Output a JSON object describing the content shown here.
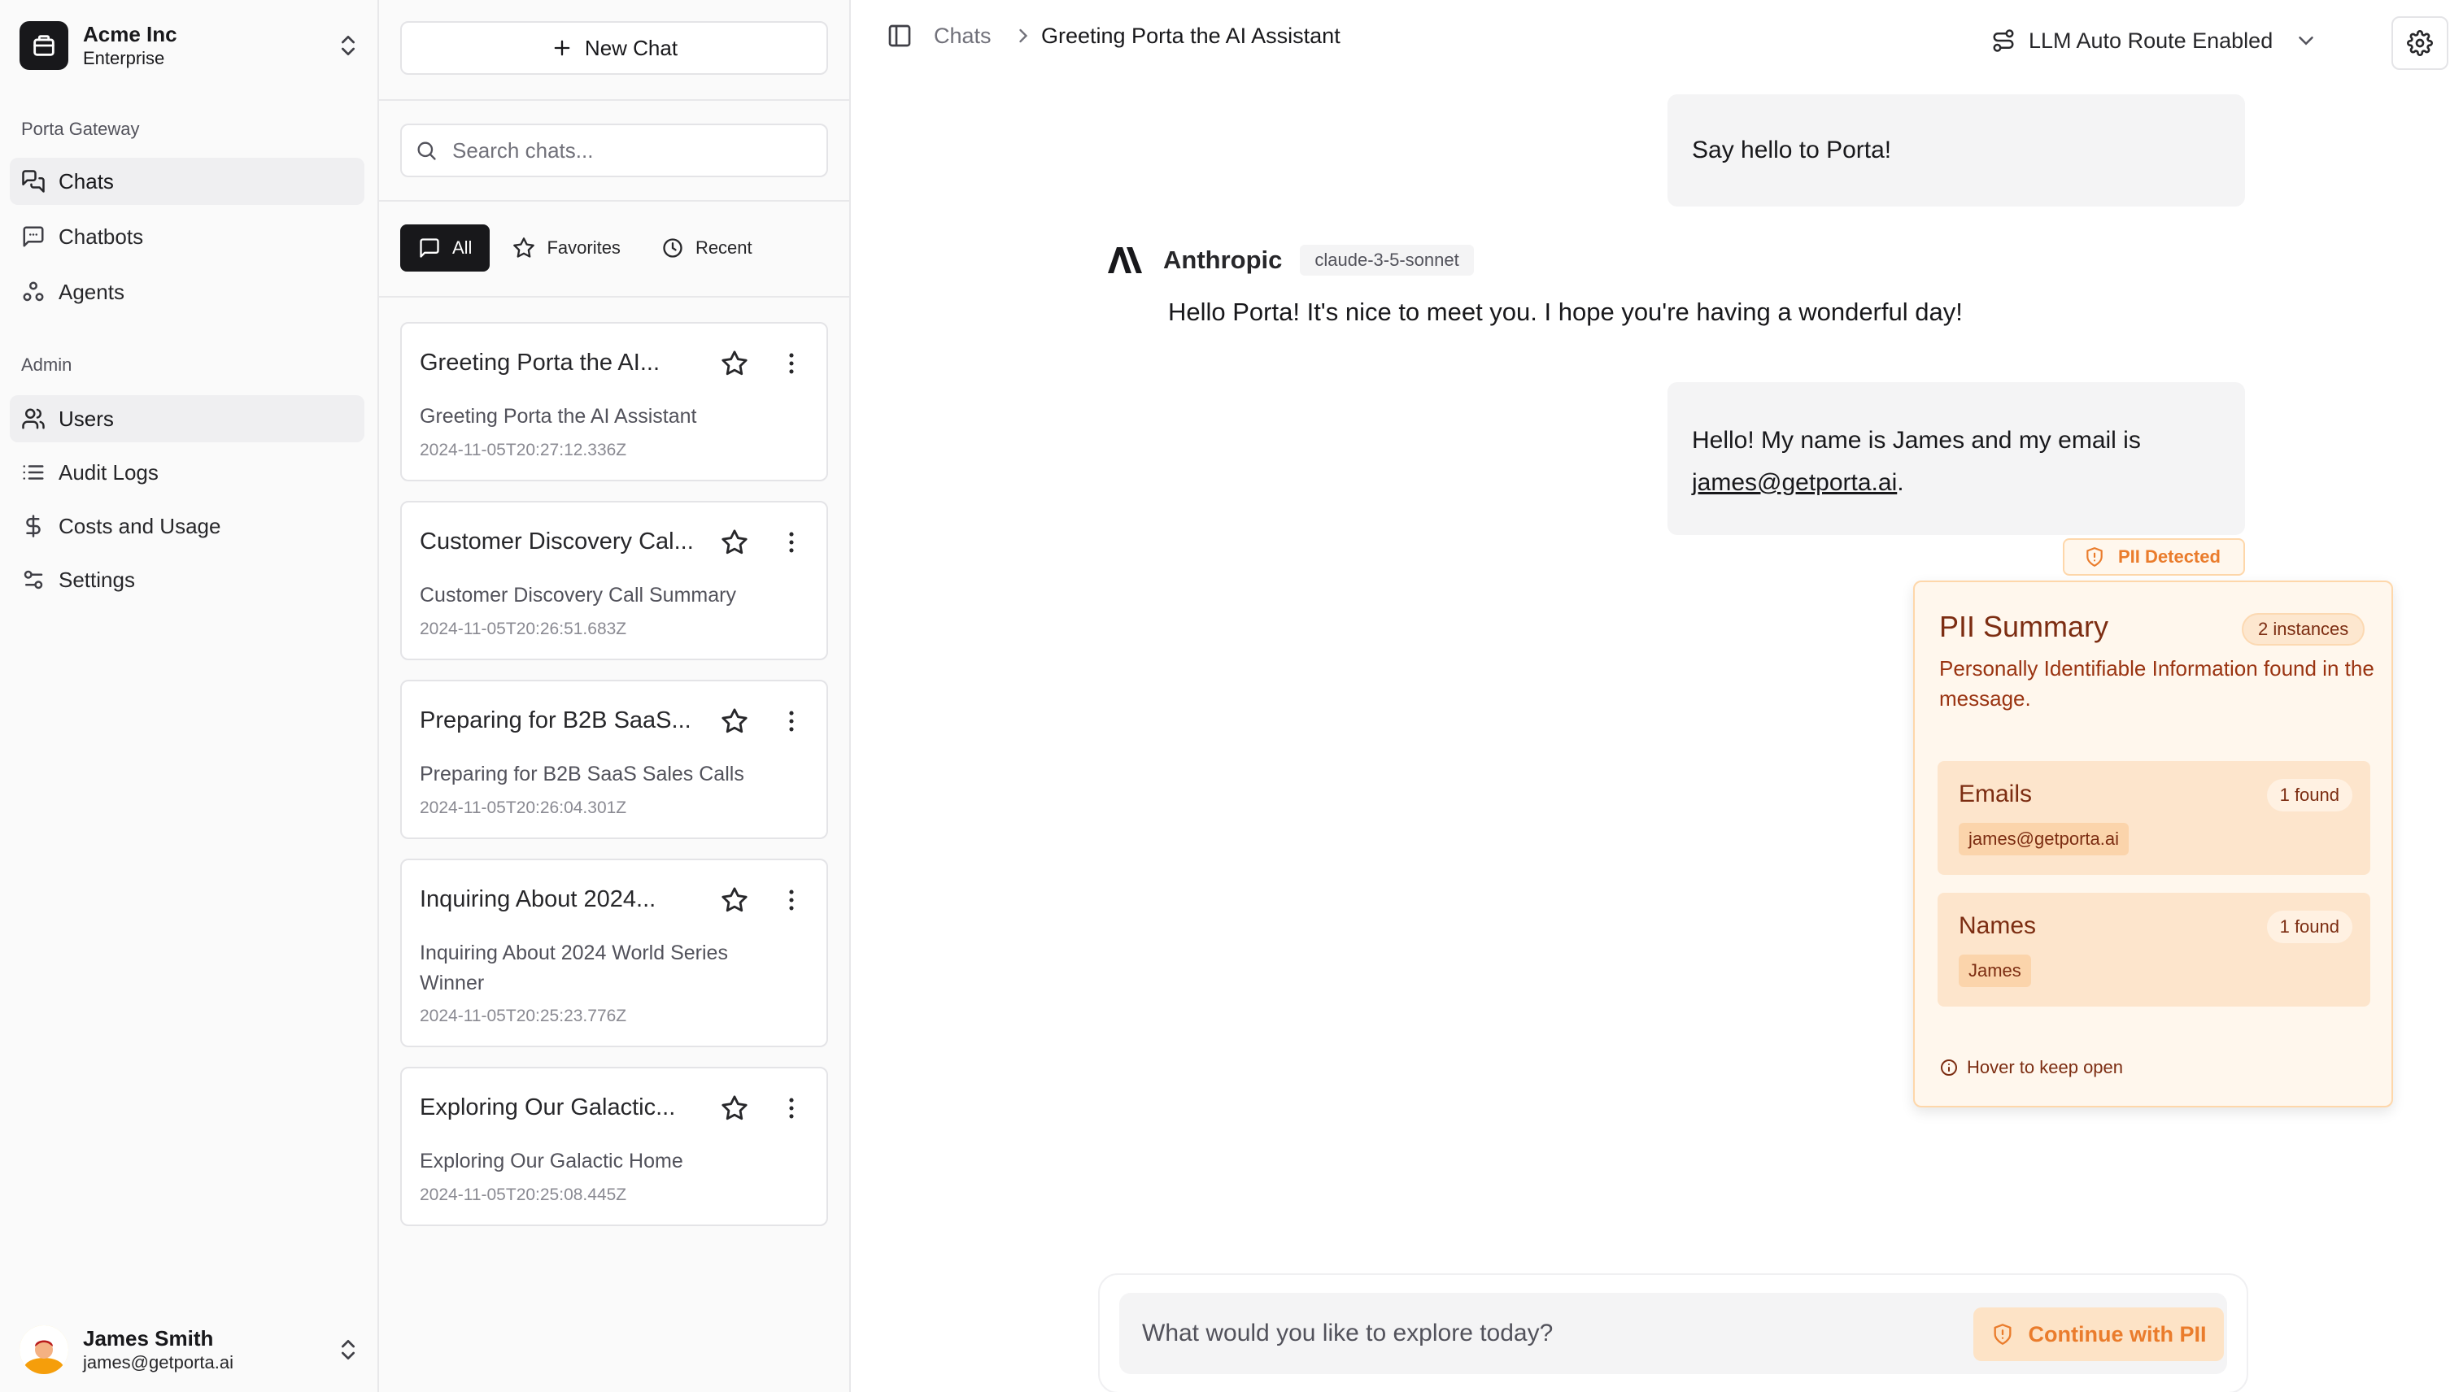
{
  "org": {
    "name": "Acme Inc",
    "plan": "Enterprise"
  },
  "sidebar": {
    "gateway_label": "Porta Gateway",
    "gateway_items": [
      {
        "label": "Chats",
        "icon": "chats-icon",
        "active": true
      },
      {
        "label": "Chatbots",
        "icon": "chatbot-icon",
        "active": false
      },
      {
        "label": "Agents",
        "icon": "agents-icon",
        "active": false
      }
    ],
    "admin_label": "Admin",
    "admin_items": [
      {
        "label": "Users",
        "icon": "users-icon",
        "active": true
      },
      {
        "label": "Audit Logs",
        "icon": "list-icon",
        "active": false
      },
      {
        "label": "Costs and Usage",
        "icon": "dollar-icon",
        "active": false
      },
      {
        "label": "Settings",
        "icon": "sliders-icon",
        "active": false
      }
    ]
  },
  "user": {
    "name": "James Smith",
    "email": "james@getporta.ai"
  },
  "chat_list": {
    "new_chat_label": "New Chat",
    "search_placeholder": "Search chats...",
    "filters": [
      "All",
      "Favorites",
      "Recent"
    ],
    "active_filter": "All",
    "items": [
      {
        "title": "Greeting Porta the AI...",
        "subtitle": "Greeting Porta the AI Assistant",
        "date": "2024-11-05T20:27:12.336Z"
      },
      {
        "title": "Customer Discovery Cal...",
        "subtitle": "Customer Discovery Call Summary",
        "date": "2024-11-05T20:26:51.683Z"
      },
      {
        "title": "Preparing for B2B SaaS...",
        "subtitle": "Preparing for B2B SaaS Sales Calls",
        "date": "2024-11-05T20:26:04.301Z"
      },
      {
        "title": "Inquiring About 2024...",
        "subtitle": "Inquiring About 2024 World Series Winner",
        "date": "2024-11-05T20:25:23.776Z"
      },
      {
        "title": "Exploring Our Galactic...",
        "subtitle": "Exploring Our Galactic Home",
        "date": "2024-11-05T20:25:08.445Z"
      }
    ]
  },
  "breadcrumb": {
    "root": "Chats",
    "current": "Greeting Porta the AI Assistant"
  },
  "route": {
    "label": "LLM Auto Route Enabled"
  },
  "conversation": {
    "user_message_1": "Say hello to Porta!",
    "assistant": {
      "provider": "Anthropic",
      "model": "claude-3-5-sonnet",
      "text": "Hello Porta! It's nice to meet you. I hope you're having a wonderful day!"
    },
    "user_message_2_prefix": "Hello! My name is James and my email is",
    "user_message_2_email": "james@getporta.ai",
    "user_message_2_suffix": "."
  },
  "pii": {
    "badge": "PII Detected",
    "title": "PII Summary",
    "count": "2 instances",
    "description": "Personally Identifiable Information found in the message.",
    "groups": [
      {
        "title": "Emails",
        "found": "1 found",
        "value": "james@getporta.ai"
      },
      {
        "title": "Names",
        "found": "1 found",
        "value": "James"
      }
    ],
    "hover_hint": "Hover to keep open"
  },
  "composer": {
    "placeholder": "What would you like to explore today?",
    "continue_label": "Continue with PII"
  },
  "colors": {
    "accent_dark": "#18181b",
    "pii_orange": "#ea7c2c",
    "pii_bg": "#fff7ed",
    "pii_text": "#7c2d12"
  }
}
